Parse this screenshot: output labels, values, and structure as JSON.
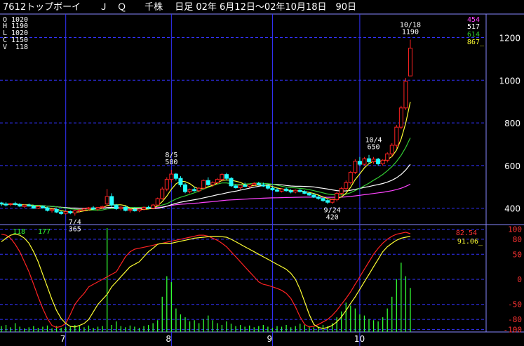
{
  "header": {
    "title": "7612トップボーイ　　Ｊ　Ｑ　　千株　 日足 02年 6月12日～02年10月18日　90日"
  },
  "ohlcv": {
    "open": {
      "label": "O",
      "value": "1020"
    },
    "high": {
      "label": "H",
      "value": "1190"
    },
    "low": {
      "label": "L",
      "value": "1020"
    },
    "close": {
      "label": "C",
      "value": "1150"
    },
    "volume": {
      "label": "V",
      "value": "118"
    }
  },
  "ma_legend": [
    {
      "value": "454",
      "color": "#ff44ff"
    },
    {
      "value": "517",
      "color": "#ffffff"
    },
    {
      "value": "614",
      "color": "#33cc33"
    },
    {
      "value": "867_",
      "color": "#ffff33"
    }
  ],
  "osc_legend": [
    {
      "value": "82.54",
      "color": "#ff3333"
    },
    {
      "value": "91.06_",
      "color": "#ffff33"
    }
  ],
  "vol_labels": [
    {
      "value": "118",
      "color": "#33ff33"
    },
    {
      "value": "177",
      "color": "#33ff33"
    }
  ],
  "annotations": [
    {
      "date": "8/5",
      "price": "580",
      "day": 37,
      "ref": 580,
      "pos": "above"
    },
    {
      "date": "7/4",
      "price": "365",
      "day": 16,
      "ref": 365,
      "pos": "below"
    },
    {
      "date": "9/24",
      "price": "420",
      "day": 72,
      "ref": 420,
      "pos": "below"
    },
    {
      "date": "10/4",
      "price": "650",
      "day": 81,
      "ref": 650,
      "pos": "above"
    },
    {
      "date": "10/18",
      "price": "1190",
      "day": 89,
      "ref": 1190,
      "pos": "above"
    }
  ],
  "colors": {
    "up": "#ff2222",
    "down": "#22ffff",
    "grid": "#3333ff",
    "text": "#ffffff",
    "volume": "#33ff33"
  },
  "chart_data": {
    "type": "candlestick",
    "ylim": [
      330,
      1310
    ],
    "price_ticks": [
      400,
      600,
      800,
      1000,
      1200
    ],
    "month_ticks": [
      {
        "label": "7",
        "day": 14
      },
      {
        "label": "8",
        "day": 37
      },
      {
        "label": "9",
        "day": 59
      },
      {
        "label": "10",
        "day": 78
      }
    ],
    "osc_ticks": [
      100,
      80,
      50,
      0,
      -50,
      -80,
      -100
    ],
    "osc_ylim": [
      -105,
      105
    ],
    "candles": [
      {
        "o": 425,
        "h": 430,
        "l": 410,
        "c": 420
      },
      {
        "o": 420,
        "h": 428,
        "l": 408,
        "c": 415
      },
      {
        "o": 418,
        "h": 425,
        "l": 410,
        "c": 422
      },
      {
        "o": 422,
        "h": 430,
        "l": 412,
        "c": 418
      },
      {
        "o": 418,
        "h": 424,
        "l": 405,
        "c": 410
      },
      {
        "o": 408,
        "h": 418,
        "l": 402,
        "c": 415
      },
      {
        "o": 415,
        "h": 422,
        "l": 408,
        "c": 410
      },
      {
        "o": 410,
        "h": 415,
        "l": 398,
        "c": 400
      },
      {
        "o": 400,
        "h": 412,
        "l": 396,
        "c": 408
      },
      {
        "o": 408,
        "h": 414,
        "l": 398,
        "c": 402
      },
      {
        "o": 402,
        "h": 406,
        "l": 385,
        "c": 390
      },
      {
        "o": 390,
        "h": 398,
        "l": 380,
        "c": 395
      },
      {
        "o": 395,
        "h": 398,
        "l": 378,
        "c": 382
      },
      {
        "o": 382,
        "h": 388,
        "l": 370,
        "c": 375
      },
      {
        "o": 376,
        "h": 386,
        "l": 370,
        "c": 384
      },
      {
        "o": 384,
        "h": 390,
        "l": 372,
        "c": 378
      },
      {
        "o": 378,
        "h": 392,
        "l": 365,
        "c": 388
      },
      {
        "o": 388,
        "h": 395,
        "l": 380,
        "c": 392
      },
      {
        "o": 392,
        "h": 402,
        "l": 386,
        "c": 398
      },
      {
        "o": 398,
        "h": 406,
        "l": 390,
        "c": 402
      },
      {
        "o": 402,
        "h": 410,
        "l": 392,
        "c": 396
      },
      {
        "o": 396,
        "h": 406,
        "l": 388,
        "c": 404
      },
      {
        "o": 404,
        "h": 412,
        "l": 398,
        "c": 408
      },
      {
        "o": 420,
        "h": 490,
        "l": 408,
        "c": 455
      },
      {
        "o": 455,
        "h": 470,
        "l": 405,
        "c": 415
      },
      {
        "o": 415,
        "h": 420,
        "l": 392,
        "c": 398
      },
      {
        "o": 398,
        "h": 410,
        "l": 390,
        "c": 405
      },
      {
        "o": 405,
        "h": 412,
        "l": 385,
        "c": 390
      },
      {
        "o": 390,
        "h": 398,
        "l": 380,
        "c": 394
      },
      {
        "o": 394,
        "h": 404,
        "l": 384,
        "c": 388
      },
      {
        "o": 388,
        "h": 398,
        "l": 382,
        "c": 396
      },
      {
        "o": 396,
        "h": 408,
        "l": 390,
        "c": 404
      },
      {
        "o": 404,
        "h": 412,
        "l": 396,
        "c": 400
      },
      {
        "o": 400,
        "h": 420,
        "l": 395,
        "c": 415
      },
      {
        "o": 415,
        "h": 450,
        "l": 410,
        "c": 445
      },
      {
        "o": 445,
        "h": 500,
        "l": 440,
        "c": 490
      },
      {
        "o": 490,
        "h": 545,
        "l": 480,
        "c": 535
      },
      {
        "o": 535,
        "h": 580,
        "l": 520,
        "c": 560
      },
      {
        "o": 560,
        "h": 565,
        "l": 530,
        "c": 540
      },
      {
        "o": 540,
        "h": 550,
        "l": 500,
        "c": 510
      },
      {
        "o": 510,
        "h": 518,
        "l": 470,
        "c": 478
      },
      {
        "o": 478,
        "h": 492,
        "l": 470,
        "c": 488
      },
      {
        "o": 488,
        "h": 500,
        "l": 478,
        "c": 482
      },
      {
        "o": 482,
        "h": 498,
        "l": 475,
        "c": 494
      },
      {
        "o": 494,
        "h": 535,
        "l": 490,
        "c": 530
      },
      {
        "o": 530,
        "h": 545,
        "l": 505,
        "c": 510
      },
      {
        "o": 510,
        "h": 526,
        "l": 500,
        "c": 520
      },
      {
        "o": 520,
        "h": 542,
        "l": 512,
        "c": 535
      },
      {
        "o": 535,
        "h": 565,
        "l": 525,
        "c": 558
      },
      {
        "o": 558,
        "h": 566,
        "l": 530,
        "c": 540
      },
      {
        "o": 540,
        "h": 546,
        "l": 500,
        "c": 505
      },
      {
        "o": 505,
        "h": 512,
        "l": 492,
        "c": 496
      },
      {
        "o": 496,
        "h": 510,
        "l": 488,
        "c": 508
      },
      {
        "o": 508,
        "h": 520,
        "l": 500,
        "c": 502
      },
      {
        "o": 502,
        "h": 514,
        "l": 496,
        "c": 510
      },
      {
        "o": 510,
        "h": 522,
        "l": 504,
        "c": 516
      },
      {
        "o": 516,
        "h": 524,
        "l": 506,
        "c": 510
      },
      {
        "o": 510,
        "h": 520,
        "l": 500,
        "c": 504
      },
      {
        "o": 504,
        "h": 512,
        "l": 488,
        "c": 494
      },
      {
        "o": 494,
        "h": 502,
        "l": 482,
        "c": 486
      },
      {
        "o": 486,
        "h": 494,
        "l": 476,
        "c": 480
      },
      {
        "o": 480,
        "h": 494,
        "l": 474,
        "c": 490
      },
      {
        "o": 490,
        "h": 496,
        "l": 478,
        "c": 482
      },
      {
        "o": 482,
        "h": 490,
        "l": 470,
        "c": 476
      },
      {
        "o": 476,
        "h": 488,
        "l": 470,
        "c": 484
      },
      {
        "o": 484,
        "h": 490,
        "l": 474,
        "c": 478
      },
      {
        "o": 478,
        "h": 484,
        "l": 466,
        "c": 470
      },
      {
        "o": 470,
        "h": 476,
        "l": 458,
        "c": 462
      },
      {
        "o": 462,
        "h": 470,
        "l": 448,
        "c": 452
      },
      {
        "o": 452,
        "h": 460,
        "l": 440,
        "c": 446
      },
      {
        "o": 446,
        "h": 452,
        "l": 430,
        "c": 436
      },
      {
        "o": 436,
        "h": 442,
        "l": 420,
        "c": 428
      },
      {
        "o": 428,
        "h": 446,
        "l": 420,
        "c": 440
      },
      {
        "o": 440,
        "h": 476,
        "l": 432,
        "c": 470
      },
      {
        "o": 470,
        "h": 500,
        "l": 460,
        "c": 492
      },
      {
        "o": 492,
        "h": 530,
        "l": 485,
        "c": 520
      },
      {
        "o": 520,
        "h": 575,
        "l": 512,
        "c": 568
      },
      {
        "o": 568,
        "h": 630,
        "l": 560,
        "c": 620
      },
      {
        "o": 620,
        "h": 640,
        "l": 598,
        "c": 606
      },
      {
        "o": 606,
        "h": 640,
        "l": 600,
        "c": 632
      },
      {
        "o": 632,
        "h": 650,
        "l": 610,
        "c": 618
      },
      {
        "o": 618,
        "h": 640,
        "l": 608,
        "c": 630
      },
      {
        "o": 630,
        "h": 636,
        "l": 600,
        "c": 608
      },
      {
        "o": 608,
        "h": 630,
        "l": 600,
        "c": 625
      },
      {
        "o": 625,
        "h": 662,
        "l": 615,
        "c": 655
      },
      {
        "o": 655,
        "h": 705,
        "l": 640,
        "c": 695
      },
      {
        "o": 695,
        "h": 790,
        "l": 680,
        "c": 780
      },
      {
        "o": 780,
        "h": 880,
        "l": 770,
        "c": 870
      },
      {
        "o": 870,
        "h": 1010,
        "l": 860,
        "c": 995
      },
      {
        "o": 1020,
        "h": 1190,
        "l": 1020,
        "c": 1150
      }
    ],
    "volume": [
      10,
      12,
      8,
      15,
      9,
      6,
      8,
      10,
      7,
      9,
      11,
      6,
      10,
      7,
      8,
      9,
      12,
      10,
      8,
      11,
      7,
      9,
      10,
      177,
      12,
      18,
      10,
      8,
      11,
      9,
      7,
      10,
      12,
      15,
      20,
      60,
      95,
      85,
      40,
      30,
      25,
      18,
      20,
      15,
      22,
      28,
      20,
      15,
      12,
      18,
      14,
      10,
      12,
      9,
      11,
      8,
      10,
      12,
      9,
      7,
      10,
      9,
      12,
      8,
      10,
      14,
      12,
      10,
      8,
      9,
      12,
      10,
      15,
      25,
      35,
      50,
      45,
      40,
      30,
      28,
      22,
      20,
      18,
      25,
      40,
      60,
      90,
      118,
      95,
      75
    ],
    "osc_k": [
      75,
      82,
      88,
      90,
      88,
      82,
      72,
      55,
      35,
      10,
      -15,
      -40,
      -62,
      -78,
      -88,
      -94,
      -95,
      -92,
      -88,
      -80,
      -65,
      -50,
      -40,
      -30,
      -15,
      -5,
      5,
      15,
      25,
      30,
      35,
      45,
      55,
      62,
      70,
      72,
      72,
      72,
      74,
      76,
      78,
      80,
      82,
      83,
      84,
      85,
      86,
      86,
      85,
      84,
      80,
      75,
      70,
      65,
      60,
      55,
      50,
      45,
      40,
      35,
      30,
      25,
      20,
      12,
      0,
      -20,
      -45,
      -70,
      -90,
      -96,
      -98,
      -96,
      -92,
      -85,
      -75,
      -62,
      -48,
      -35,
      -20,
      -5,
      10,
      25,
      40,
      55,
      65,
      72,
      78,
      82,
      84,
      86
    ],
    "osc_d": [
      90,
      88,
      82,
      70,
      55,
      35,
      15,
      -10,
      -35,
      -58,
      -78,
      -92,
      -96,
      -94,
      -88,
      -70,
      -50,
      -38,
      -28,
      -15,
      -10,
      -5,
      0,
      5,
      10,
      15,
      30,
      45,
      55,
      60,
      62,
      64,
      66,
      68,
      70,
      72,
      74,
      76,
      78,
      80,
      82,
      84,
      86,
      88,
      88,
      86,
      82,
      78,
      72,
      65,
      55,
      45,
      35,
      25,
      15,
      5,
      -5,
      -10,
      -12,
      -15,
      -18,
      -22,
      -28,
      -38,
      -55,
      -75,
      -90,
      -95,
      -94,
      -90,
      -85,
      -80,
      -72,
      -62,
      -50,
      -38,
      -25,
      -10,
      5,
      20,
      35,
      50,
      62,
      72,
      80,
      86,
      90,
      92,
      94,
      91
    ]
  }
}
